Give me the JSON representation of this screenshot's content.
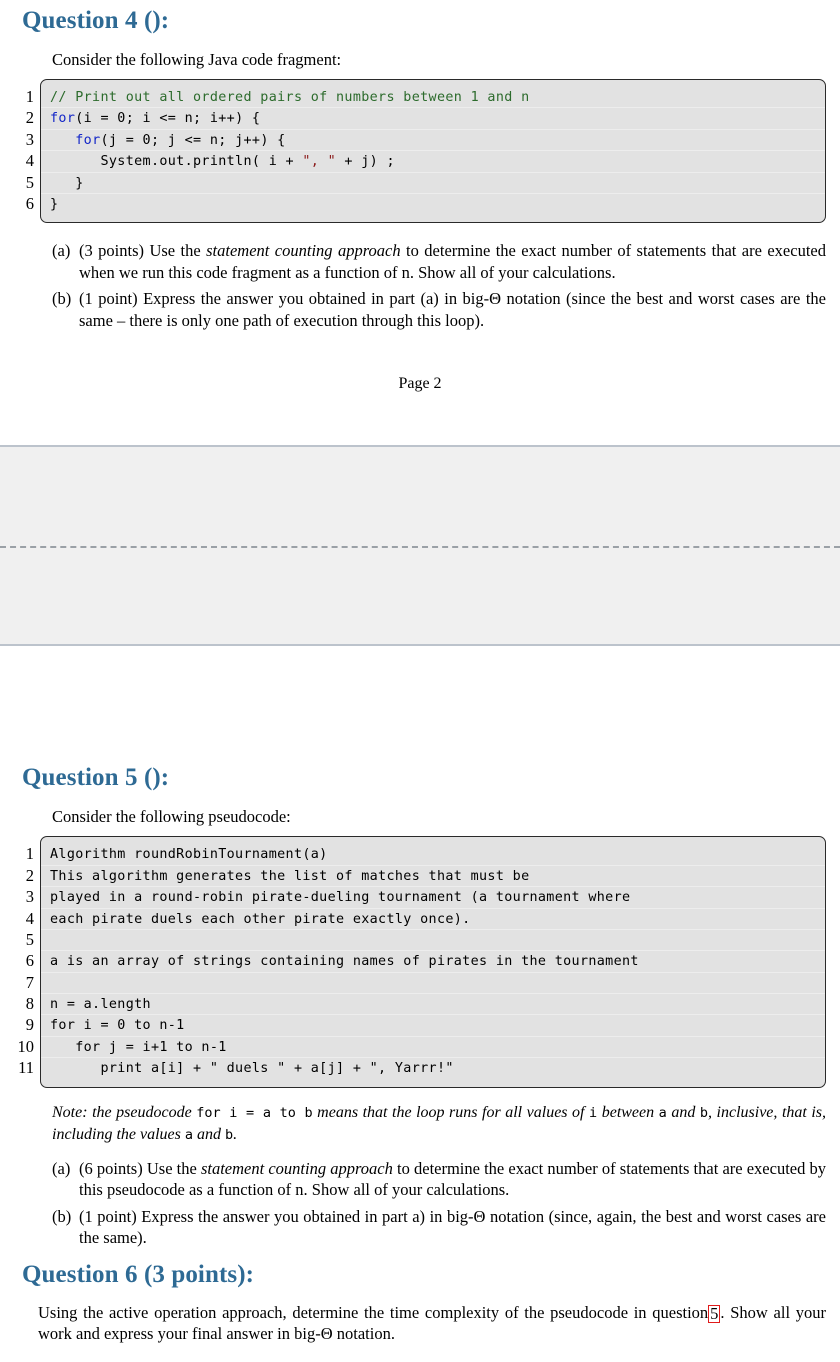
{
  "document": {
    "page_number_label": "Page 2"
  },
  "question4": {
    "heading": "Question 4 ():",
    "intro": "Consider the following Java code fragment:",
    "code": {
      "language": "java",
      "line_numbers": [
        "1",
        "2",
        "3",
        "4",
        "5",
        "6"
      ],
      "lines": [
        [
          {
            "t": "// Print out all ordered pairs of numbers between 1 and n",
            "k": "comment"
          }
        ],
        [
          {
            "t": "for",
            "k": "keyword"
          },
          {
            "t": "(i = 0; i <= n; i++) {",
            "k": "plain"
          }
        ],
        [
          {
            "t": "   ",
            "k": "plain"
          },
          {
            "t": "for",
            "k": "keyword"
          },
          {
            "t": "(j = 0; j <= n; j++) {",
            "k": "plain"
          }
        ],
        [
          {
            "t": "      System.out.println( i + ",
            "k": "plain"
          },
          {
            "t": "\", \"",
            "k": "string"
          },
          {
            "t": " + j) ;",
            "k": "plain"
          }
        ],
        [
          {
            "t": "   }",
            "k": "plain"
          }
        ],
        [
          {
            "t": "}",
            "k": "plain"
          }
        ]
      ]
    },
    "items": [
      {
        "label": "(a)",
        "parts": [
          {
            "t": "(3 points)  Use the ",
            "style": "normal"
          },
          {
            "t": "statement counting approach",
            "style": "italic"
          },
          {
            "t": " to determine the exact number of statements that are executed when we run this code fragment as a function of n. Show all of your calculations.",
            "style": "normal"
          }
        ]
      },
      {
        "label": "(b)",
        "parts": [
          {
            "t": "(1 point)  Express the answer you obtained in part (a) in big-Θ notation (since the best and worst cases are the same – there is only one path of execution through this loop).",
            "style": "normal"
          }
        ]
      }
    ]
  },
  "question5": {
    "heading": "Question 5 ():",
    "intro": "Consider the following pseudocode:",
    "code": {
      "language": "pseudocode",
      "line_numbers": [
        "1",
        "2",
        "3",
        "4",
        "5",
        "6",
        "7",
        "8",
        "9",
        "10",
        "11"
      ],
      "lines": [
        [
          {
            "t": "Algorithm roundRobinTournament(a)",
            "k": "plain"
          }
        ],
        [
          {
            "t": "This algorithm generates the list of matches that must be",
            "k": "plain"
          }
        ],
        [
          {
            "t": "played in a round-robin pirate-dueling tournament (a tournament where",
            "k": "plain"
          }
        ],
        [
          {
            "t": "each pirate duels each other pirate exactly once).",
            "k": "plain"
          }
        ],
        [
          {
            "t": "",
            "k": "plain"
          }
        ],
        [
          {
            "t": "a is an array of strings containing names of pirates in the tournament",
            "k": "plain"
          }
        ],
        [
          {
            "t": "",
            "k": "plain"
          }
        ],
        [
          {
            "t": "n = a.length",
            "k": "plain"
          }
        ],
        [
          {
            "t": "for i = 0 to n-1",
            "k": "plain"
          }
        ],
        [
          {
            "t": "   for j = i+1 to n-1",
            "k": "plain"
          }
        ],
        [
          {
            "t": "      print a[i] + \" duels \" + a[j] + \", Yarrr!\"",
            "k": "plain"
          }
        ]
      ]
    },
    "note": [
      {
        "t": "Note: the pseudocode ",
        "style": "italic"
      },
      {
        "t": "for i = a to b",
        "style": "mono"
      },
      {
        "t": " means that the loop runs for all values of ",
        "style": "italic"
      },
      {
        "t": "i",
        "style": "mono"
      },
      {
        "t": " between ",
        "style": "italic"
      },
      {
        "t": "a",
        "style": "mono"
      },
      {
        "t": " and ",
        "style": "italic"
      },
      {
        "t": "b",
        "style": "mono"
      },
      {
        "t": ", inclusive, that is, including the values ",
        "style": "italic"
      },
      {
        "t": "a",
        "style": "mono"
      },
      {
        "t": " and ",
        "style": "italic"
      },
      {
        "t": "b",
        "style": "mono"
      },
      {
        "t": ".",
        "style": "italic"
      }
    ],
    "items": [
      {
        "label": "(a)",
        "parts": [
          {
            "t": "(6 points)  Use the ",
            "style": "normal"
          },
          {
            "t": "statement counting approach",
            "style": "italic"
          },
          {
            "t": " to determine the exact number of statements that are executed by this pseudocode as a function of n. Show all of your calculations.",
            "style": "normal"
          }
        ]
      },
      {
        "label": "(b)",
        "parts": [
          {
            "t": "(1 point)  Express the answer you obtained in part a) in big-Θ notation (since, again, the best and worst cases are the same).",
            "style": "normal"
          }
        ]
      }
    ]
  },
  "question6": {
    "heading": "Question 6 (3 points):",
    "body_before_ref": "Using the active operation approach, determine the time complexity of the pseudocode in question",
    "broken_reference": "5",
    "body_after_ref": ". Show all your work and express your final answer in big-Θ notation."
  },
  "colors": {
    "heading_blue": "#2e6a94",
    "code_background": "#e2e2e2",
    "code_border": "#2a2a2a",
    "comment_green": "#2c6b2c",
    "keyword_blue": "#1326c8",
    "string_red": "#8b1a1a",
    "broken_ref_red": "#e01b1b",
    "pagebreak_band": "#f0f0f0",
    "pagebreak_border": "#bcc3cc"
  }
}
